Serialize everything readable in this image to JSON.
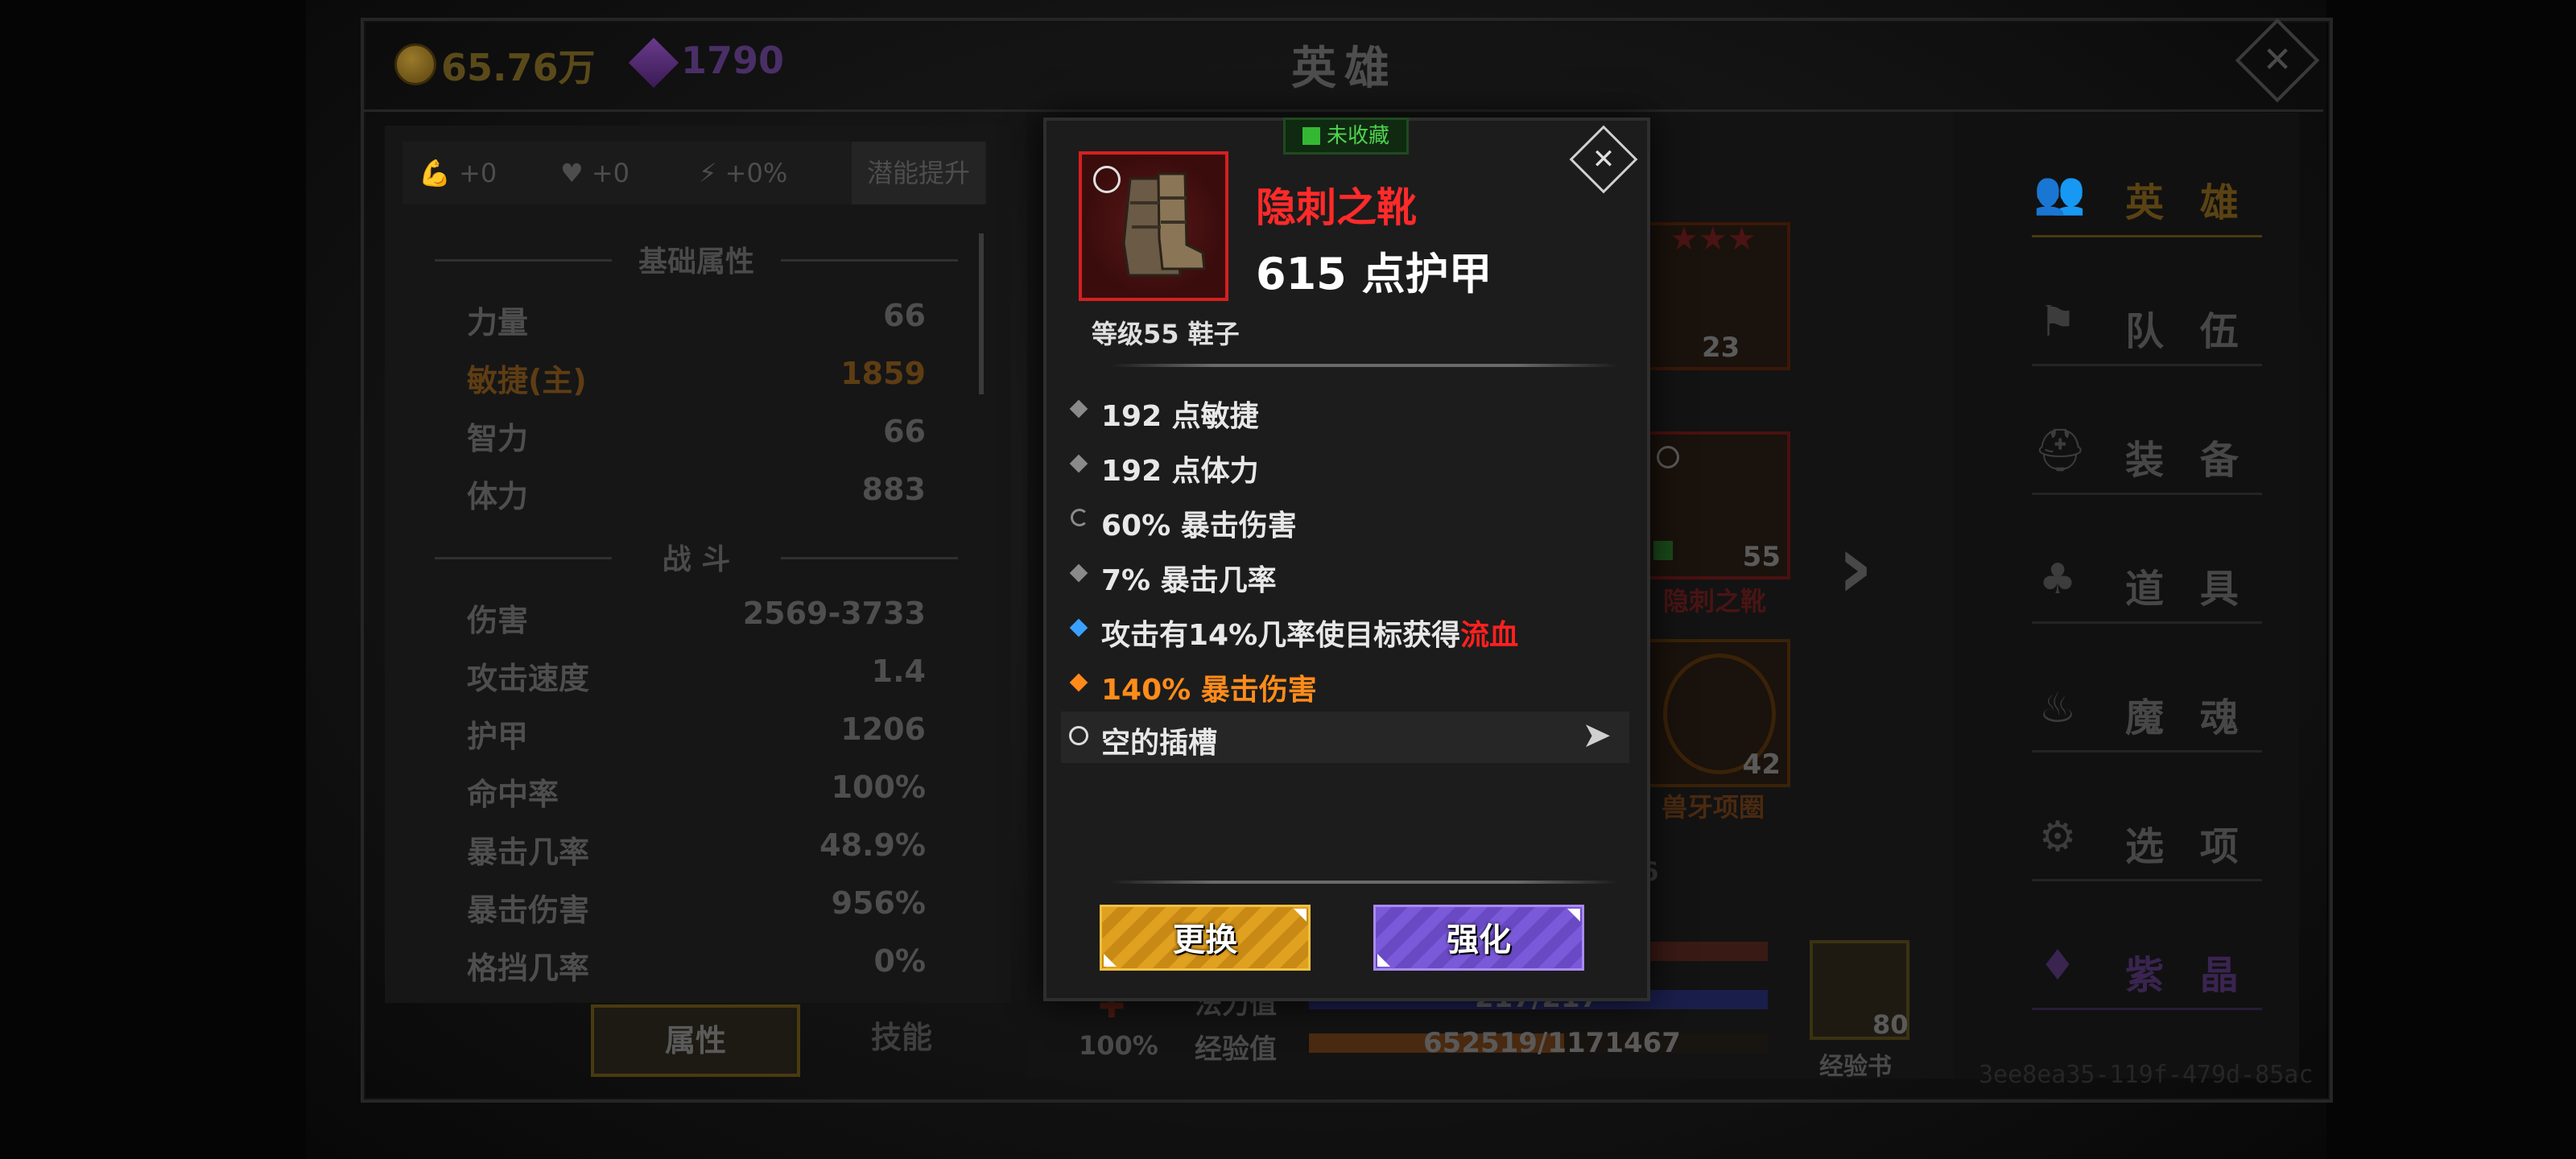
{
  "currency": {
    "gold": "65.76万",
    "gems": "1790"
  },
  "screen_title": "英雄",
  "stat_bar": {
    "might": "+0",
    "life": "+0",
    "energy": "+0%",
    "potential_button": "潜能提升"
  },
  "basic_section": "基础属性",
  "basic_stats": [
    {
      "label": "力量",
      "value": "66"
    },
    {
      "label": "敏捷(主)",
      "value": "1859"
    },
    {
      "label": "智力",
      "value": "66"
    },
    {
      "label": "体力",
      "value": "883"
    }
  ],
  "combat_section": "战 斗",
  "combat_stats": [
    {
      "label": "伤害",
      "value": "2569-3733"
    },
    {
      "label": "攻击速度",
      "value": "1.4"
    },
    {
      "label": "护甲",
      "value": "1206"
    },
    {
      "label": "命中率",
      "value": "100%"
    },
    {
      "label": "暴击几率",
      "value": "48.9%"
    },
    {
      "label": "暴击伤害",
      "value": "956%"
    },
    {
      "label": "格挡几率",
      "value": "0%"
    }
  ],
  "tabs": {
    "attributes": "属性",
    "skills": "技能"
  },
  "equipment": [
    {
      "level": "23",
      "name": ""
    },
    {
      "level": "55",
      "name": "隐刺之靴"
    },
    {
      "level": "42",
      "name": "兽牙项圈"
    }
  ],
  "partial_level": "56",
  "bars": {
    "mana_label": "法力值",
    "mana_value": "217/217",
    "xp_label": "经验值",
    "xp_value": "652519/1171467",
    "xp_fraction": 0.557,
    "potion_percent": "100%"
  },
  "xp_book": {
    "count": "80",
    "label": "经验书"
  },
  "nav": [
    "英 雄",
    "队 伍",
    "装 备",
    "道 具",
    "魔 魂",
    "选 项",
    "紫 晶"
  ],
  "build_id": "3ee8ea35-119f-479d-85ac",
  "modal": {
    "collect_tag": "未收藏",
    "item_name": "隐刺之靴",
    "armor": "615 点护甲",
    "level_type": "等级55 鞋子",
    "props": [
      {
        "type": "plain",
        "text": "192 点敏捷"
      },
      {
        "type": "plain",
        "text": "192 点体力"
      },
      {
        "type": "refresh",
        "text": "60% 暴击伤害"
      },
      {
        "type": "plain",
        "text": "7% 暴击几率"
      }
    ],
    "special_prefix": "攻击有14%几率使目标获得",
    "special_keyword": "流血",
    "legendary": "140% 暴击伤害",
    "socket": "空的插槽",
    "btn_replace": "更换",
    "btn_enhance": "强化"
  }
}
